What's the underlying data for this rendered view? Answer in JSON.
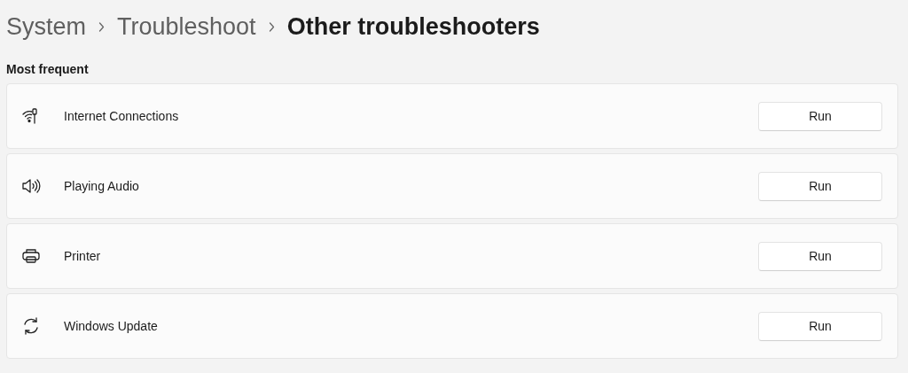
{
  "breadcrumb": [
    {
      "label": "System",
      "current": false
    },
    {
      "label": "Troubleshoot",
      "current": false
    },
    {
      "label": "Other troubleshooters",
      "current": true
    }
  ],
  "section": {
    "title": "Most frequent"
  },
  "items": [
    {
      "kind": "network",
      "label": "Internet Connections",
      "button": "Run"
    },
    {
      "kind": "audio",
      "label": "Playing Audio",
      "button": "Run"
    },
    {
      "kind": "printer",
      "label": "Printer",
      "button": "Run"
    },
    {
      "kind": "update",
      "label": "Windows Update",
      "button": "Run"
    }
  ]
}
